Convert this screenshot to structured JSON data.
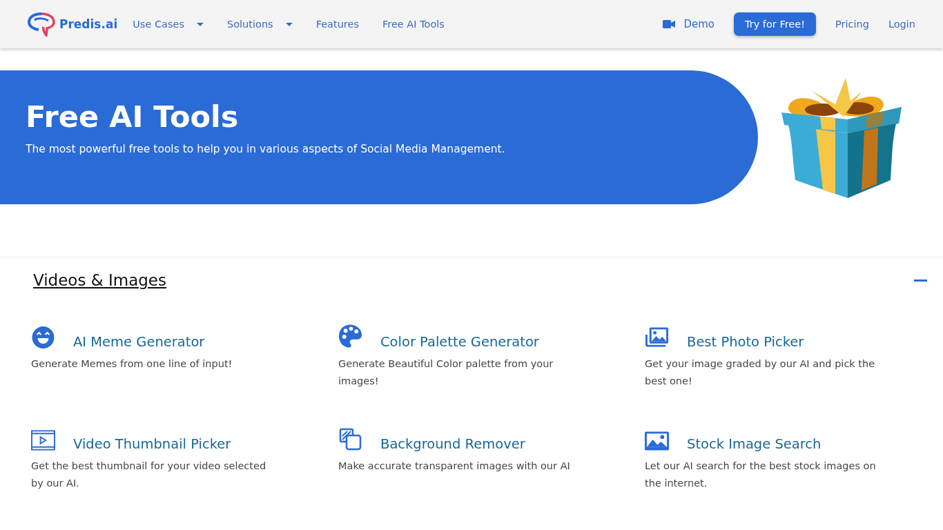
{
  "header": {
    "logo": "Predis.ai",
    "nav": [
      {
        "label": "Use Cases",
        "kind": "dropdown"
      },
      {
        "label": "Solutions",
        "kind": "dropdown"
      },
      {
        "label": "Features",
        "kind": "link"
      },
      {
        "label": "Free AI Tools",
        "kind": "link"
      }
    ],
    "actions": [
      {
        "label": "Demo",
        "kind": "video-link"
      },
      {
        "label": "Try for Free!",
        "kind": "button"
      },
      {
        "label": "Pricing",
        "kind": "link"
      },
      {
        "label": "Login",
        "kind": "link"
      }
    ]
  },
  "hero": {
    "title": "Free AI Tools",
    "subtitle": "The most powerful free tools to help you in various aspects of Social Media Management."
  },
  "section": {
    "title": "Videos & Images",
    "expanded": true,
    "tools": [
      {
        "kind": "emoji",
        "title": "AI Meme Generator",
        "description": "Generate Memes from one line of input!"
      },
      {
        "kind": "palette",
        "title": "Color Palette Generator",
        "description": "Generate Beautiful Color palette from your images!"
      },
      {
        "kind": "photos",
        "title": "Best Photo Picker",
        "description": "Get your image graded by our AI and pick the best one!"
      },
      {
        "kind": "video",
        "title": "Video Thumbnail Picker",
        "description": "Get the best thumbnail for your video selected by our AI."
      },
      {
        "kind": "layers",
        "title": "Background Remover",
        "description": "Make accurate transparent images with our AI"
      },
      {
        "kind": "image",
        "title": "Stock Image Search",
        "description": "Let our AI search for the best stock images on the internet."
      }
    ]
  }
}
